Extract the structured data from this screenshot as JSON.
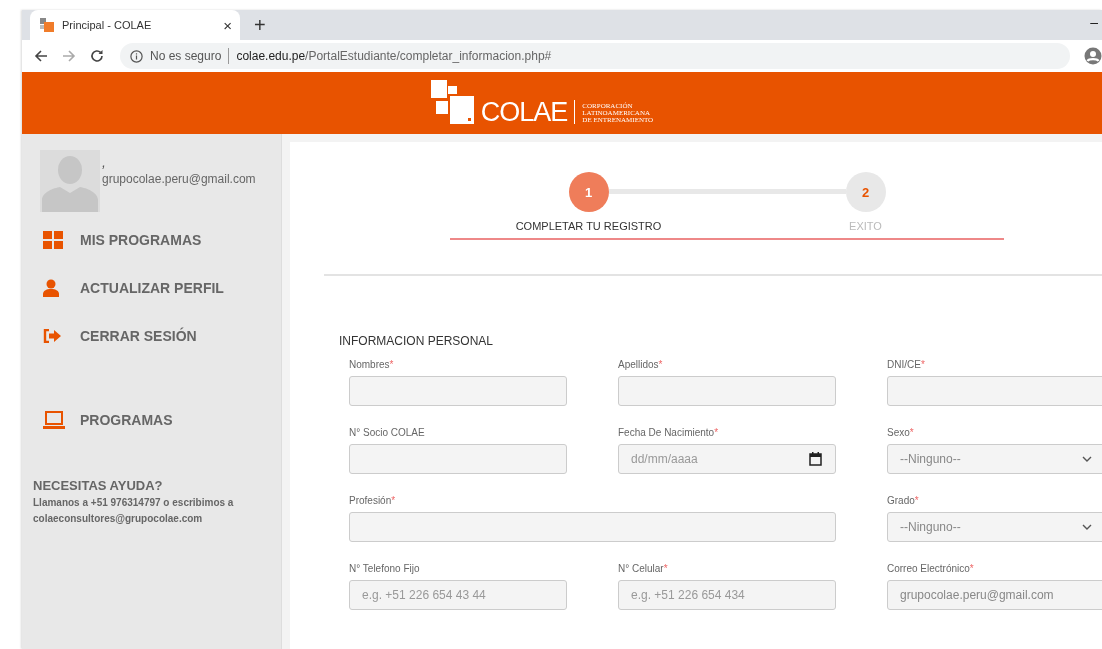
{
  "browser": {
    "tab_title": "Principal - COLAE",
    "tab_close": "×",
    "new_tab": "+",
    "minimize": "–",
    "security": "No es seguro",
    "url_domain": "colae.edu.pe",
    "url_path": "/PortalEstudiante/completar_informacion.php#"
  },
  "header": {
    "logo_text": "COLAE",
    "logo_tagline": [
      "CORPORACIÓN",
      "LATINOAMERICANA",
      "DE ENTRENAMIENTO"
    ]
  },
  "sidebar": {
    "user_name": ",",
    "user_email": "grupocolae.peru@gmail.com",
    "menu": [
      {
        "kind": "grid",
        "label": "MIS PROGRAMAS"
      },
      {
        "kind": "person",
        "label": "ACTUALIZAR PERFIL"
      },
      {
        "kind": "logout",
        "label": "CERRAR SESIÓN"
      }
    ],
    "secondary_menu": [
      {
        "kind": "laptop",
        "label": "PROGRAMAS"
      }
    ],
    "help_title": "NECESITAS AYUDA?",
    "help_text": "Llamanos a +51 976314797 o escribimos a colaeconsultores@grupocolae.com"
  },
  "steps": [
    {
      "number": "1",
      "label": "COMPLETAR TU REGISTRO",
      "selected": true
    },
    {
      "number": "2",
      "label": "EXITO",
      "selected": false
    }
  ],
  "section_title": "INFORMACION PERSONAL",
  "form_rows": [
    [
      {
        "kind": "text",
        "label": "Nombres",
        "required_mark": "*",
        "wide": false
      },
      {
        "kind": "text",
        "label": "Apellidos",
        "required_mark": "*",
        "wide": false
      },
      {
        "kind": "text",
        "label": "DNI/CE",
        "required_mark": "*",
        "wide": false
      }
    ],
    [
      {
        "kind": "text",
        "label": "N° Socio COLAE",
        "wide": false
      },
      {
        "kind": "date",
        "label": "Fecha De Nacimiento",
        "required_mark": "*",
        "wide": false,
        "placeholder": "dd/mm/aaaa"
      },
      {
        "kind": "select",
        "label": "Sexo",
        "required_mark": "*",
        "wide": false,
        "value": "--Ninguno--"
      }
    ],
    [
      {
        "kind": "text",
        "label": "Profesión",
        "required_mark": "*",
        "wide": true
      },
      {
        "kind": "select",
        "label": "Grado",
        "required_mark": "*",
        "wide": false,
        "value": "--Ninguno--"
      }
    ],
    [
      {
        "kind": "text",
        "label": "N° Telefono Fijo",
        "wide": false,
        "placeholder": "e.g. +51 226 654 43 44"
      },
      {
        "kind": "text",
        "label": "N° Celular",
        "required_mark": "*",
        "wide": false,
        "placeholder": "e.g. +51 226 654 434"
      },
      {
        "kind": "text",
        "label": "Correo Electrónico",
        "required_mark": "*",
        "wide": false,
        "value": "grupocolae.peru@gmail.com"
      }
    ]
  ]
}
